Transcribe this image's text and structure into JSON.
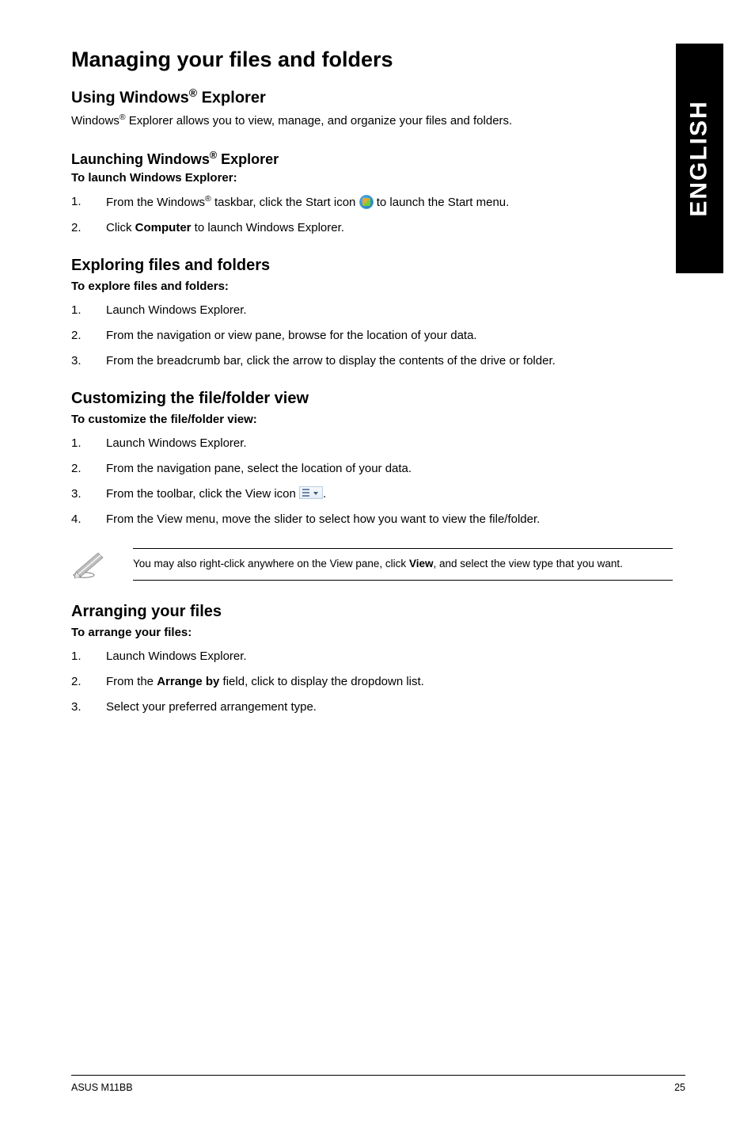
{
  "tab": "ENGLISH",
  "h1": "Managing your files and folders",
  "s1": {
    "h2_pre": "Using Windows",
    "h2_post": " Explorer",
    "intro_pre": "Windows",
    "intro_post": " Explorer allows you to view, manage, and organize your files and folders."
  },
  "s2": {
    "h3_pre": "Launching Windows",
    "h3_post": " Explorer",
    "sub": "To launch Windows Explorer:",
    "items": [
      {
        "num": "1.",
        "pre": "From the Windows",
        "mid": " taskbar, click the Start icon ",
        "post": " to launch the Start menu."
      },
      {
        "num": "2.",
        "pre": "Click ",
        "bold": "Computer",
        "post": " to launch Windows Explorer."
      }
    ]
  },
  "s3": {
    "h2": "Exploring files and folders",
    "sub": "To explore files and folders:",
    "items": [
      {
        "num": "1.",
        "text": "Launch Windows Explorer."
      },
      {
        "num": "2.",
        "text": "From the navigation or view pane, browse for the location of your data."
      },
      {
        "num": "3.",
        "text": "From the breadcrumb bar, click the arrow to display the contents of the drive or folder."
      }
    ]
  },
  "s4": {
    "h2": "Customizing the file/folder view",
    "sub": "To customize the file/folder view:",
    "items": [
      {
        "num": "1.",
        "text": "Launch Windows Explorer."
      },
      {
        "num": "2.",
        "text": "From the navigation pane, select the location of your data."
      },
      {
        "num": "3.",
        "pre": "From the toolbar, click the View icon ",
        "post": "."
      },
      {
        "num": "4.",
        "text": "From the View menu, move the slider to select how you want to view the file/folder."
      }
    ],
    "note_pre": "You may also right-click anywhere on the View pane, click ",
    "note_bold": "View",
    "note_post": ", and select the view type that you want."
  },
  "s5": {
    "h2": "Arranging your files",
    "sub": "To arrange your files:",
    "items": [
      {
        "num": "1.",
        "text": "Launch Windows Explorer."
      },
      {
        "num": "2.",
        "pre": "From the ",
        "bold": "Arrange by",
        "post": " field, click to display the dropdown list."
      },
      {
        "num": "3.",
        "text": "Select your preferred arrangement type."
      }
    ]
  },
  "footer": {
    "left": "ASUS M11BB",
    "right": "25"
  }
}
